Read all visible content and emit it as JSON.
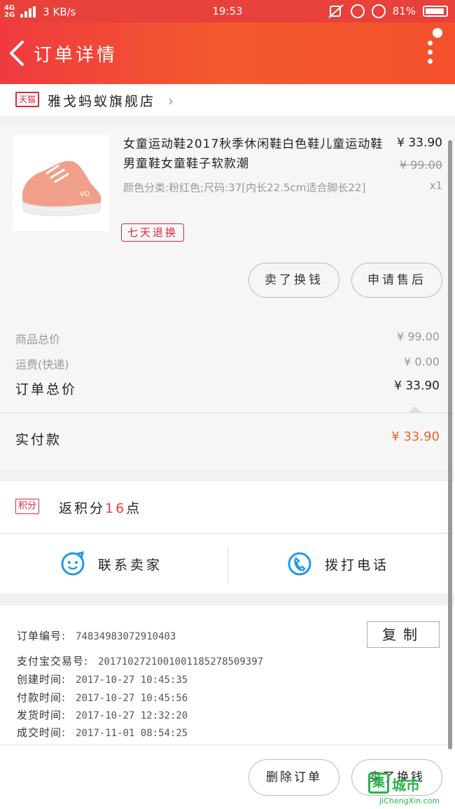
{
  "status_bar": {
    "network_top": "4G",
    "network_bottom": "2G",
    "speed": "3 KB/s",
    "time": "19:53",
    "battery": "81%"
  },
  "header": {
    "title": "订单详情"
  },
  "shop": {
    "badge": "天猫",
    "name": "雅戈蚂蚁旗舰店"
  },
  "product": {
    "title": "女童运动鞋2017秋季休闲鞋白色鞋儿童运动鞋男童鞋女童鞋子软款潮",
    "sku": "颜色分类:粉红色;尺码:37[内长22.5cm适合脚长22]",
    "price": "¥ 33.90",
    "original_price": "¥ 99.00",
    "quantity": "x1",
    "tag": "七天退换",
    "btn_resell": "卖了换钱",
    "btn_after_sale": "申请售后"
  },
  "totals": {
    "goods_label": "商品总价",
    "goods_value": "¥ 99.00",
    "shipping_label": "运费(快递)",
    "shipping_value": "¥ 0.00",
    "order_label": "订单总价",
    "order_value": "¥ 33.90",
    "paid_label": "实付款",
    "paid_value": "¥ 33.90"
  },
  "points": {
    "badge": "积分",
    "prefix": "返积分",
    "count": "16",
    "suffix": "点"
  },
  "contact": {
    "seller_label": "联系卖家",
    "call_label": "拨打电话"
  },
  "order_info": {
    "order_no_label": "订单编号:",
    "order_no": "7483498307291040З",
    "alipay_label": "支付宝交易号:",
    "alipay_no": "2017102721001001185278509397",
    "created_label": "创建时间:",
    "created": "2017-10-27 10:45:35",
    "paid_label": "付款时间:",
    "paid": "2017-10-27 10:45:56",
    "shipped_label": "发货时间:",
    "shipped": "2017-10-27 12:32:20",
    "done_label": "成交时间:",
    "done": "2017-11-01 08:54:25",
    "copy_label": "复制"
  },
  "footer": {
    "delete_label": "删除订单",
    "resell_label": "卖了换钱"
  },
  "watermark": {
    "icon": "集",
    "text": "城市",
    "url": "JiChengXin.com"
  },
  "colors": {
    "accent": "#e8403a",
    "tmall_red": "#d9283b",
    "paid_orange": "#f0642c",
    "watermark_green": "#2bb24c"
  }
}
